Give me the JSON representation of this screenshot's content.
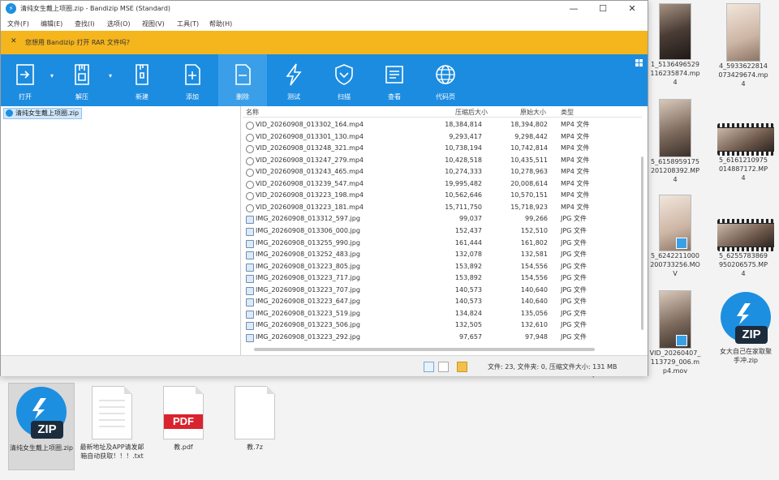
{
  "window": {
    "title": "清纯女生戴上项圈.zip - Bandizip MSE (Standard)",
    "controls": {
      "minimize": "—",
      "maximize": "☐",
      "close": "✕"
    }
  },
  "menu": [
    "文件(F)",
    "编辑(E)",
    "查找(I)",
    "选项(O)",
    "视图(V)",
    "工具(T)",
    "帮助(H)"
  ],
  "notice": {
    "close": "✕",
    "text": "您想用 Bandizip 打开 RAR 文件吗?"
  },
  "toolbar": [
    {
      "label": "打开",
      "icon": "open-icon"
    },
    {
      "label": "解压",
      "icon": "extract-icon"
    },
    {
      "label": "新建",
      "icon": "new-archive-icon"
    },
    {
      "label": "添加",
      "icon": "add-file-icon"
    },
    {
      "label": "删除",
      "icon": "delete-file-icon"
    },
    {
      "label": "测试",
      "icon": "test-lightning-icon"
    },
    {
      "label": "扫描",
      "icon": "scan-shield-icon"
    },
    {
      "label": "查看",
      "icon": "view-icon"
    },
    {
      "label": "代码页",
      "icon": "codepage-globe-icon"
    }
  ],
  "tree": {
    "root": "清纯女生戴上项圈.zip"
  },
  "list": {
    "columns": [
      "名称",
      "压缩后大小",
      "原始大小",
      "类型"
    ],
    "rows": [
      {
        "name": "VID_20260908_013302_164.mp4",
        "packed": "18,384,814",
        "size": "18,394,802",
        "type": "MP4 文件",
        "kind": "video"
      },
      {
        "name": "VID_20260908_013301_130.mp4",
        "packed": "9,293,417",
        "size": "9,298,442",
        "type": "MP4 文件",
        "kind": "video"
      },
      {
        "name": "VID_20260908_013248_321.mp4",
        "packed": "10,738,194",
        "size": "10,742,814",
        "type": "MP4 文件",
        "kind": "video"
      },
      {
        "name": "VID_20260908_013247_279.mp4",
        "packed": "10,428,518",
        "size": "10,435,511",
        "type": "MP4 文件",
        "kind": "video"
      },
      {
        "name": "VID_20260908_013243_465.mp4",
        "packed": "10,274,333",
        "size": "10,278,963",
        "type": "MP4 文件",
        "kind": "video"
      },
      {
        "name": "VID_20260908_013239_547.mp4",
        "packed": "19,995,482",
        "size": "20,008,614",
        "type": "MP4 文件",
        "kind": "video"
      },
      {
        "name": "VID_20260908_013223_198.mp4",
        "packed": "10,562,646",
        "size": "10,570,151",
        "type": "MP4 文件",
        "kind": "video"
      },
      {
        "name": "VID_20260908_013223_181.mp4",
        "packed": "15,711,750",
        "size": "15,718,923",
        "type": "MP4 文件",
        "kind": "video"
      },
      {
        "name": "IMG_20260908_013312_597.jpg",
        "packed": "99,037",
        "size": "99,266",
        "type": "JPG 文件",
        "kind": "image"
      },
      {
        "name": "IMG_20260908_013306_000.jpg",
        "packed": "152,437",
        "size": "152,510",
        "type": "JPG 文件",
        "kind": "image"
      },
      {
        "name": "IMG_20260908_013255_990.jpg",
        "packed": "161,444",
        "size": "161,802",
        "type": "JPG 文件",
        "kind": "image"
      },
      {
        "name": "IMG_20260908_013252_483.jpg",
        "packed": "132,078",
        "size": "132,581",
        "type": "JPG 文件",
        "kind": "image"
      },
      {
        "name": "IMG_20260908_013223_805.jpg",
        "packed": "153,892",
        "size": "154,556",
        "type": "JPG 文件",
        "kind": "image"
      },
      {
        "name": "IMG_20260908_013223_717.jpg",
        "packed": "153,892",
        "size": "154,556",
        "type": "JPG 文件",
        "kind": "image"
      },
      {
        "name": "IMG_20260908_013223_707.jpg",
        "packed": "140,573",
        "size": "140,640",
        "type": "JPG 文件",
        "kind": "image"
      },
      {
        "name": "IMG_20260908_013223_647.jpg",
        "packed": "140,573",
        "size": "140,640",
        "type": "JPG 文件",
        "kind": "image"
      },
      {
        "name": "IMG_20260908_013223_519.jpg",
        "packed": "134,824",
        "size": "135,056",
        "type": "JPG 文件",
        "kind": "image"
      },
      {
        "name": "IMG_20260908_013223_506.jpg",
        "packed": "132,505",
        "size": "132,610",
        "type": "JPG 文件",
        "kind": "image"
      },
      {
        "name": "IMG_20260908_013223_292.jpg",
        "packed": "97,657",
        "size": "97,948",
        "type": "JPG 文件",
        "kind": "image"
      }
    ]
  },
  "status": {
    "text": "文件: 23, 文件夹: 0, 压缩文件大小: 131 MB"
  },
  "desktop": {
    "right_icons": [
      {
        "label": "1_5136496529116235874.mp4"
      },
      {
        "label": "4_5933622814073429674.mp4"
      },
      {
        "label": "5_6158959175201208392.MP4"
      },
      {
        "label": "5_6161210975014887172.MP4"
      },
      {
        "label": "5_6242211000200733256.MOV"
      },
      {
        "label": "5_6255783869950206575.MP4"
      },
      {
        "label": "VID_20260407_113729_006.mp4.mov"
      },
      {
        "label": "女大自己在家取聚手冲.zip"
      }
    ],
    "bottom_icons": [
      {
        "label": "清纯女生戴上项圈.zip"
      },
      {
        "label": "最新地址及APP请发邮箱自动获取！！！.txt"
      },
      {
        "label": "教.pdf"
      },
      {
        "label": "教.7z"
      }
    ],
    "partial_labels": [
      "4",
      "4",
      "V",
      "4",
      "4",
      "4",
      "4",
      "p4.mov"
    ],
    "zip_badge": "ZIP",
    "pdf_badge": "PDF"
  }
}
